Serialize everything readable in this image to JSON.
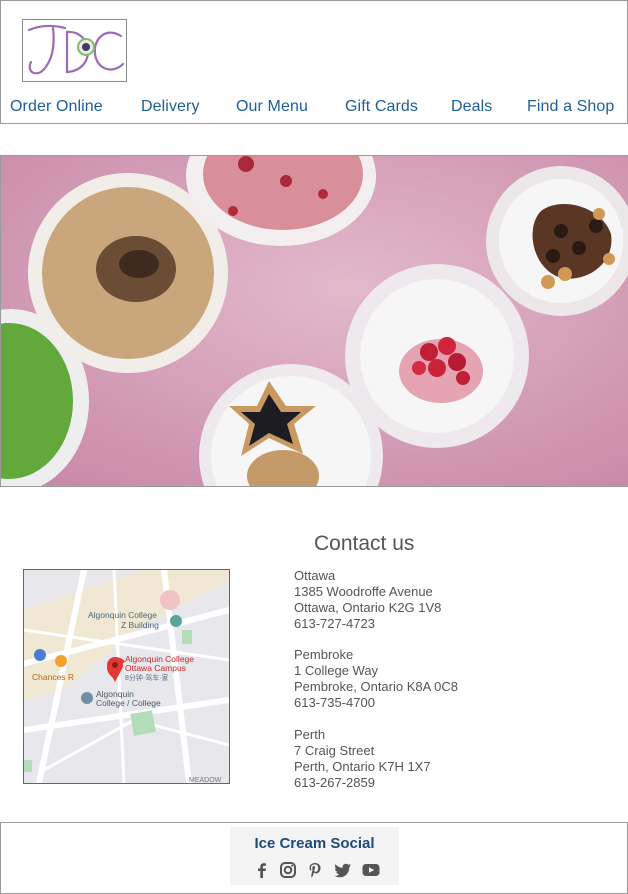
{
  "header": {
    "logo_icon": "jdc-logo",
    "nav": [
      {
        "label": "Order Online"
      },
      {
        "label": "Delivery"
      },
      {
        "label": "Our Menu"
      },
      {
        "label": "Gift Cards"
      },
      {
        "label": "Deals"
      },
      {
        "label": "Find a Shop"
      }
    ],
    "accent_color": "#1d5e9a"
  },
  "hero": {
    "image": "ice-cream-tubs-photo"
  },
  "contact": {
    "title": "Contact us",
    "map": {
      "labels": {
        "z_building": "Algonquin College\nZ Building",
        "campus": "Algonquin College\nOttawa Campus",
        "campus_sub": "8分钟·驾车·家",
        "chances": "Chances R",
        "college": "Algonquin\nCollege / College",
        "corner": "MEADOW"
      }
    },
    "locations": [
      {
        "city": "Ottawa",
        "street": "1385 Woodroffe Avenue",
        "region": "Ottawa, Ontario K2G 1V8",
        "phone": "613-727-4723"
      },
      {
        "city": "Pembroke",
        "street": "1 College Way",
        "region": "Pembroke, Ontario K8A 0C8",
        "phone": "613-735-4700"
      },
      {
        "city": "Perth",
        "street": "7 Craig Street",
        "region": "Perth, Ontario K7H 1X7",
        "phone": "613-267-2859"
      }
    ]
  },
  "footer": {
    "social_title": "Ice Cream Social",
    "icons": [
      "facebook-icon",
      "instagram-icon",
      "pinterest-icon",
      "twitter-icon",
      "youtube-icon"
    ]
  }
}
